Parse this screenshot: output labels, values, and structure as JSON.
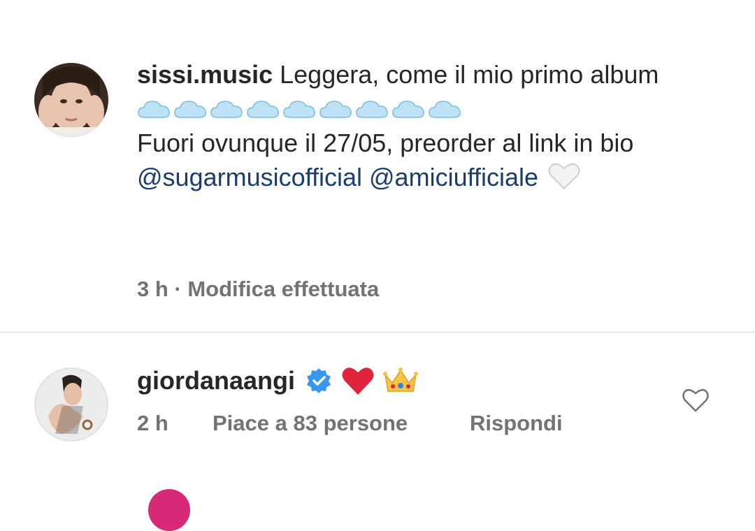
{
  "caption": {
    "username": "sissi.music",
    "text_line1": "Leggera, come il mio primo album",
    "cloud_emoji_count_label": "☁☁☁☁☁☁☁☁☁",
    "text_line2": "Fuori ovunque il 27/05, preorder al link in bio",
    "mention1": "@sugarmusicofficial",
    "mention2": "@amiciufficiale",
    "meta": "3 h · Modifica effettuata"
  },
  "comment": {
    "username": "giordanaangi",
    "time": "2 h",
    "likes": "Piace a 83 persone",
    "reply": "Rispondi"
  },
  "icons": {
    "verified": "verified-badge-icon",
    "heart_outline": "heart-outline-icon",
    "white_heart": "white-heart-emoji",
    "red_heart": "red-heart-emoji",
    "crown": "crown-emoji",
    "cloud": "cloud-emoji"
  },
  "colors": {
    "text": "#262626",
    "secondary": "#737373",
    "mention": "#1a3d6d",
    "verified": "#3897f0",
    "divider": "#dbdbdb"
  }
}
